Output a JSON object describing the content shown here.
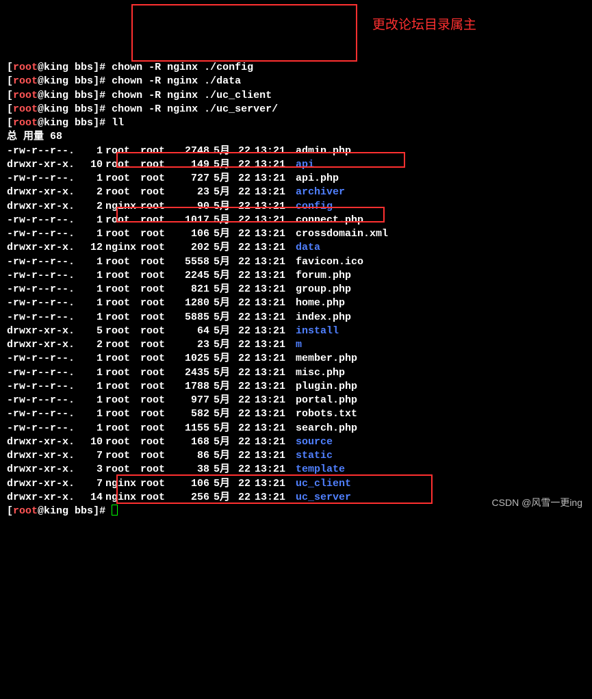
{
  "prompt": {
    "open": "[",
    "user": "root",
    "at": "@",
    "host": "king",
    "cwd": "bbs",
    "close": "]#"
  },
  "commands": {
    "c1": "chown -R nginx ./config",
    "c2": "chown -R nginx ./data",
    "c3": "chown -R nginx ./uc_client",
    "c4": "chown -R nginx ./uc_server/",
    "c5": "ll"
  },
  "annotation": "更改论坛目录属主",
  "total_label": "总 用量 68",
  "files": [
    {
      "perm": "-rw-r--r--.",
      "links": "1",
      "owner": "root",
      "group": "root",
      "size": "2748",
      "month": "5月",
      "day": "22",
      "time": "13:21",
      "name": "admin.php",
      "dir": false
    },
    {
      "perm": "drwxr-xr-x.",
      "links": "10",
      "owner": "root",
      "group": "root",
      "size": "149",
      "month": "5月",
      "day": "22",
      "time": "13:21",
      "name": "api",
      "dir": true
    },
    {
      "perm": "-rw-r--r--.",
      "links": "1",
      "owner": "root",
      "group": "root",
      "size": "727",
      "month": "5月",
      "day": "22",
      "time": "13:21",
      "name": "api.php",
      "dir": false
    },
    {
      "perm": "drwxr-xr-x.",
      "links": "2",
      "owner": "root",
      "group": "root",
      "size": "23",
      "month": "5月",
      "day": "22",
      "time": "13:21",
      "name": "archiver",
      "dir": true
    },
    {
      "perm": "drwxr-xr-x.",
      "links": "2",
      "owner": "nginx",
      "group": "root",
      "size": "90",
      "month": "5月",
      "day": "22",
      "time": "13:21",
      "name": "config",
      "dir": true
    },
    {
      "perm": "-rw-r--r--.",
      "links": "1",
      "owner": "root",
      "group": "root",
      "size": "1017",
      "month": "5月",
      "day": "22",
      "time": "13:21",
      "name": "connect.php",
      "dir": false
    },
    {
      "perm": "-rw-r--r--.",
      "links": "1",
      "owner": "root",
      "group": "root",
      "size": "106",
      "month": "5月",
      "day": "22",
      "time": "13:21",
      "name": "crossdomain.xml",
      "dir": false
    },
    {
      "perm": "drwxr-xr-x.",
      "links": "12",
      "owner": "nginx",
      "group": "root",
      "size": "202",
      "month": "5月",
      "day": "22",
      "time": "13:21",
      "name": "data",
      "dir": true
    },
    {
      "perm": "-rw-r--r--.",
      "links": "1",
      "owner": "root",
      "group": "root",
      "size": "5558",
      "month": "5月",
      "day": "22",
      "time": "13:21",
      "name": "favicon.ico",
      "dir": false
    },
    {
      "perm": "-rw-r--r--.",
      "links": "1",
      "owner": "root",
      "group": "root",
      "size": "2245",
      "month": "5月",
      "day": "22",
      "time": "13:21",
      "name": "forum.php",
      "dir": false
    },
    {
      "perm": "-rw-r--r--.",
      "links": "1",
      "owner": "root",
      "group": "root",
      "size": "821",
      "month": "5月",
      "day": "22",
      "time": "13:21",
      "name": "group.php",
      "dir": false
    },
    {
      "perm": "-rw-r--r--.",
      "links": "1",
      "owner": "root",
      "group": "root",
      "size": "1280",
      "month": "5月",
      "day": "22",
      "time": "13:21",
      "name": "home.php",
      "dir": false
    },
    {
      "perm": "-rw-r--r--.",
      "links": "1",
      "owner": "root",
      "group": "root",
      "size": "5885",
      "month": "5月",
      "day": "22",
      "time": "13:21",
      "name": "index.php",
      "dir": false
    },
    {
      "perm": "drwxr-xr-x.",
      "links": "5",
      "owner": "root",
      "group": "root",
      "size": "64",
      "month": "5月",
      "day": "22",
      "time": "13:21",
      "name": "install",
      "dir": true
    },
    {
      "perm": "drwxr-xr-x.",
      "links": "2",
      "owner": "root",
      "group": "root",
      "size": "23",
      "month": "5月",
      "day": "22",
      "time": "13:21",
      "name": "m",
      "dir": true
    },
    {
      "perm": "-rw-r--r--.",
      "links": "1",
      "owner": "root",
      "group": "root",
      "size": "1025",
      "month": "5月",
      "day": "22",
      "time": "13:21",
      "name": "member.php",
      "dir": false
    },
    {
      "perm": "-rw-r--r--.",
      "links": "1",
      "owner": "root",
      "group": "root",
      "size": "2435",
      "month": "5月",
      "day": "22",
      "time": "13:21",
      "name": "misc.php",
      "dir": false
    },
    {
      "perm": "-rw-r--r--.",
      "links": "1",
      "owner": "root",
      "group": "root",
      "size": "1788",
      "month": "5月",
      "day": "22",
      "time": "13:21",
      "name": "plugin.php",
      "dir": false
    },
    {
      "perm": "-rw-r--r--.",
      "links": "1",
      "owner": "root",
      "group": "root",
      "size": "977",
      "month": "5月",
      "day": "22",
      "time": "13:21",
      "name": "portal.php",
      "dir": false
    },
    {
      "perm": "-rw-r--r--.",
      "links": "1",
      "owner": "root",
      "group": "root",
      "size": "582",
      "month": "5月",
      "day": "22",
      "time": "13:21",
      "name": "robots.txt",
      "dir": false
    },
    {
      "perm": "-rw-r--r--.",
      "links": "1",
      "owner": "root",
      "group": "root",
      "size": "1155",
      "month": "5月",
      "day": "22",
      "time": "13:21",
      "name": "search.php",
      "dir": false
    },
    {
      "perm": "drwxr-xr-x.",
      "links": "10",
      "owner": "root",
      "group": "root",
      "size": "168",
      "month": "5月",
      "day": "22",
      "time": "13:21",
      "name": "source",
      "dir": true
    },
    {
      "perm": "drwxr-xr-x.",
      "links": "7",
      "owner": "root",
      "group": "root",
      "size": "86",
      "month": "5月",
      "day": "22",
      "time": "13:21",
      "name": "static",
      "dir": true
    },
    {
      "perm": "drwxr-xr-x.",
      "links": "3",
      "owner": "root",
      "group": "root",
      "size": "38",
      "month": "5月",
      "day": "22",
      "time": "13:21",
      "name": "template",
      "dir": true
    },
    {
      "perm": "drwxr-xr-x.",
      "links": "7",
      "owner": "nginx",
      "group": "root",
      "size": "106",
      "month": "5月",
      "day": "22",
      "time": "13:21",
      "name": "uc_client",
      "dir": true
    },
    {
      "perm": "drwxr-xr-x.",
      "links": "14",
      "owner": "nginx",
      "group": "root",
      "size": "256",
      "month": "5月",
      "day": "22",
      "time": "13:21",
      "name": "uc_server",
      "dir": true
    }
  ],
  "watermark": "CSDN @风雪一更ing"
}
